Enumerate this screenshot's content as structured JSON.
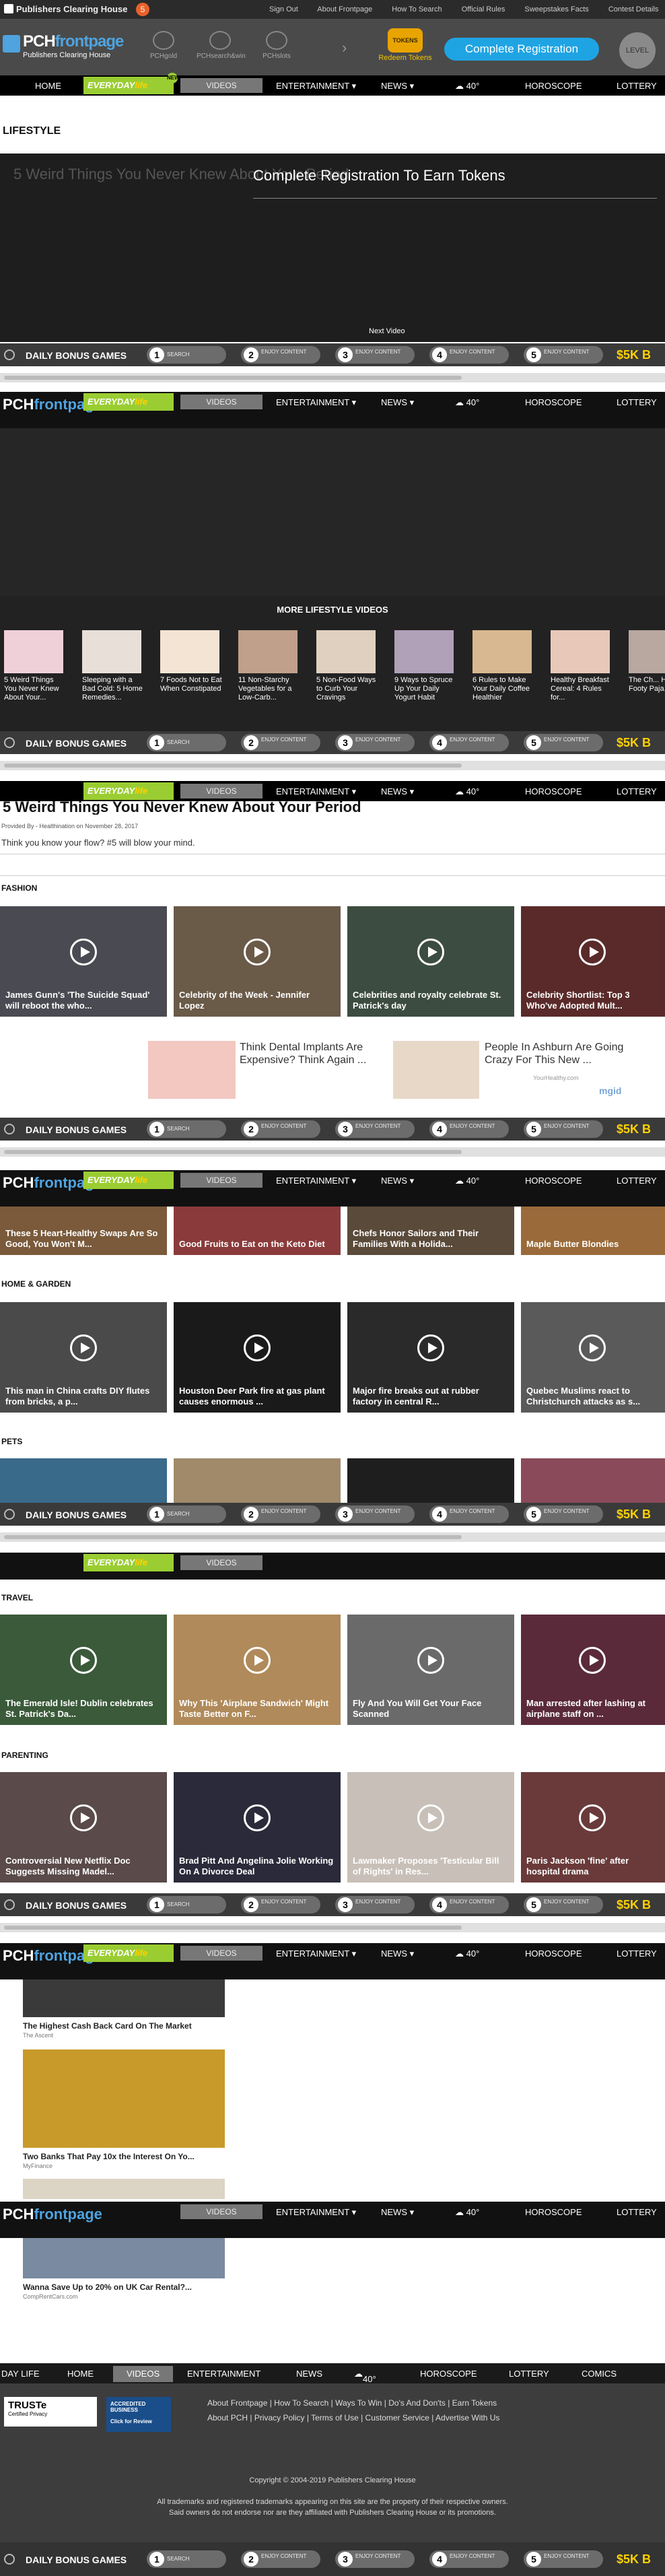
{
  "util": {
    "brand": "Publishers Clearing House",
    "badge": "5",
    "links": [
      "Sign Out",
      "About Frontpage",
      "How To Search",
      "Official Rules",
      "Sweepstakes Facts",
      "Contest Details"
    ]
  },
  "header": {
    "logo_a": "PCH",
    "logo_b": "frontpage",
    "logo_sub": "Publishers Clearing House",
    "icons": [
      "PCHgold",
      "PCHsearch&win",
      "PCHslots"
    ],
    "redeem_label": "Redeem Tokens",
    "redeem_coin": "TOKENS",
    "register": "Complete Registration",
    "level": "LEVEL"
  },
  "nav": {
    "home": "HOME",
    "everyday_a": "EVERYDAY",
    "everyday_b": "life",
    "new": "NEW",
    "videos": "VIDEOS",
    "entertainment": "ENTERTAINMENT ▾",
    "news": "NEWS ▾",
    "temp": "40°",
    "horoscope": "HOROSCOPE",
    "lottery": "LOTTERY"
  },
  "bonus": {
    "label": "DAILY BONUS GAMES",
    "steps": [
      {
        "n": "1",
        "s": "SEARCH"
      },
      {
        "n": "2",
        "s": "ENJOY CONTENT"
      },
      {
        "n": "3",
        "s": "ENJOY CONTENT"
      },
      {
        "n": "4",
        "s": "ENJOY CONTENT"
      },
      {
        "n": "5",
        "s": "ENJOY CONTENT"
      }
    ],
    "prize": "$5K B"
  },
  "lifestyle": {
    "heading": "LIFESTYLE",
    "video_title": "5 Weird Things You Never Knew About Your Period",
    "overlay": "Complete Registration To Earn Tokens",
    "next": "Next Video",
    "more": "MORE LIFESTYLE VIDEOS",
    "thumbs": [
      "5 Weird Things You Never Knew About Your...",
      "Sleeping with a Bad Cold: 5 Home Remedies...",
      "7 Foods Not to Eat When Constipated",
      "11 Non-Starchy Vegetables for a Low-Carb...",
      "5 Non-Food Ways to Curb Your Cravings",
      "9 Ways to Spruce Up Your Daily Yogurt Habit",
      "6 Rules to Make Your Daily Coffee Healthier",
      "Healthy Breakfast Cereal: 4 Rules for...",
      "The Ch... History Footy Paja..."
    ],
    "article_title": "5 Weird Things You Never Knew About Your Period",
    "provided": "Provided By - Healthination on November 28, 2017",
    "desc": "Think you know your flow? #5 will blow your mind."
  },
  "fashion": {
    "heading": "FASHION",
    "cards": [
      "James Gunn's 'The Suicide Squad' will reboot the who...",
      "Celebrity of the Week - Jennifer Lopez",
      "Celebrities and royalty celebrate St. Patrick's day",
      "Celebrity Shortlist: Top 3 Who've Adopted Mult..."
    ]
  },
  "ads": {
    "a1": "Think Dental Implants Are Expensive? Think Again ...",
    "a2": "People In Ashburn Are Going Crazy For This New ...",
    "a2_src": "YourHealthy.com",
    "mgid": "mgid"
  },
  "food": {
    "cards": [
      "These 5 Heart-Healthy Swaps Are So Good, You Won't M...",
      "Good Fruits to Eat on the Keto Diet",
      "Chefs Honor Sailors and Their Families With a Holida...",
      "Maple Butter Blondies"
    ]
  },
  "home": {
    "heading": "HOME & GARDEN",
    "cards": [
      "This man in China crafts DIY flutes from bricks, a p...",
      "Houston Deer Park fire at gas plant causes enormous ...",
      "Major fire breaks out at rubber factory in central R...",
      "Quebec Muslims react to Christchurch attacks as s..."
    ]
  },
  "pets": {
    "heading": "PETS"
  },
  "travel": {
    "heading": "TRAVEL",
    "cards": [
      "The Emerald Isle! Dublin celebrates St. Patrick's Da...",
      "Why This 'Airplane Sandwich' Might Taste Better on F...",
      "Fly And You Will Get Your Face Scanned",
      "Man arrested after lashing at airplane staff on ..."
    ]
  },
  "parenting": {
    "heading": "PARENTING",
    "cards": [
      "Controversial New Netflix Doc Suggests Missing Madel...",
      "Brad Pitt And Angelina Jolie Working On A Divorce Deal",
      "Lawmaker Proposes 'Testicular Bill of Rights' in Res...",
      "Paris Jackson 'fine' after hospital drama"
    ]
  },
  "sponsored": [
    {
      "title": "The Highest Cash Back Card On The Market",
      "src": "The Ascent"
    },
    {
      "title": "Two Banks That Pay 10x the Interest On Yo...",
      "src": "MyFinance"
    },
    {
      "title": "Wanna Save Up to 20% on UK Car Rental?...",
      "src": "CompRentCars.com"
    }
  ],
  "footer": {
    "nav": [
      "DAY LIFE",
      "HOME",
      "VIDEOS",
      "ENTERTAINMENT",
      "NEWS",
      "40°",
      "HOROSCOPE",
      "LOTTERY",
      "COMICS"
    ],
    "links1": "About Frontpage | How To Search | Ways To Win | Do's And Don'ts | Earn Tokens",
    "links2": "About PCH | Privacy Policy | Terms of Use | Customer Service | Advertise With Us",
    "copyright": "Copyright © 2004-2019 Publishers Clearing House",
    "tm1": "All trademarks and registered trademarks appearing on this site are the property of their respective owners.",
    "tm2": "Said owners do not endorse nor are they affiliated with Publishers Clearing House or its promotions.",
    "truste": "TRUSTe",
    "truste_sub": "Certified Privacy",
    "bbb": "ACCREDITED BUSINESS",
    "bbb_sub": "Click for Review"
  }
}
